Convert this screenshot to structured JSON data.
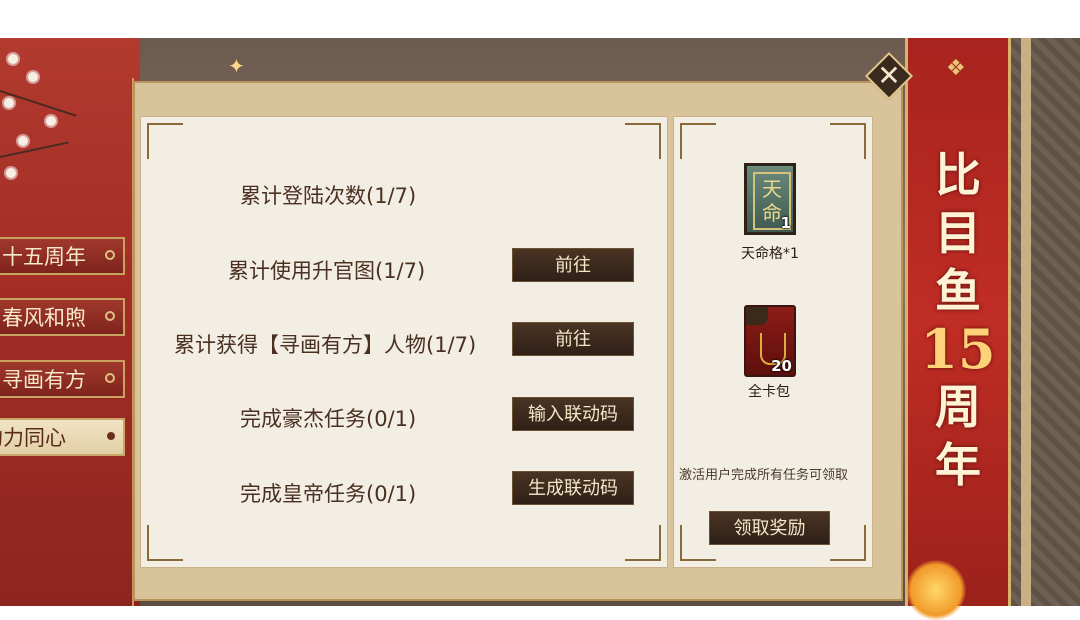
{
  "tabs": [
    {
      "label": "十五周年",
      "active": false
    },
    {
      "label": "春风和煦",
      "active": false
    },
    {
      "label": "寻画有方",
      "active": false
    },
    {
      "label": "勠力同心",
      "active": true
    }
  ],
  "tasks": [
    {
      "label": "累计登陆次数(1/7)",
      "button": ""
    },
    {
      "label": "累计使用升官图(1/7)",
      "button": "前往"
    },
    {
      "label": "累计获得【寻画有方】人物(1/7)",
      "button": "前往"
    },
    {
      "label": "完成豪杰任务(0/1)",
      "button": "输入联动码"
    },
    {
      "label": "完成皇帝任务(0/1)",
      "button": "生成联动码"
    }
  ],
  "rewards": [
    {
      "name": "天命格*1",
      "count": "1",
      "card_text": [
        "天",
        "命"
      ],
      "icon": "tianming-card-icon"
    },
    {
      "name": "全卡包",
      "count": "20",
      "icon": "card-pack-icon"
    }
  ],
  "reward_note": "激活用户完成所有任务可领取",
  "claim_button": "领取奖励",
  "banner": {
    "chars": [
      "比",
      "目",
      "鱼",
      "15",
      "周",
      "年"
    ]
  },
  "close_icon": "close-icon",
  "colors": {
    "accent_red": "#b23a2e",
    "gold": "#d7b46a",
    "button_dark": "#2f2016",
    "parchment": "#f3eee4"
  }
}
